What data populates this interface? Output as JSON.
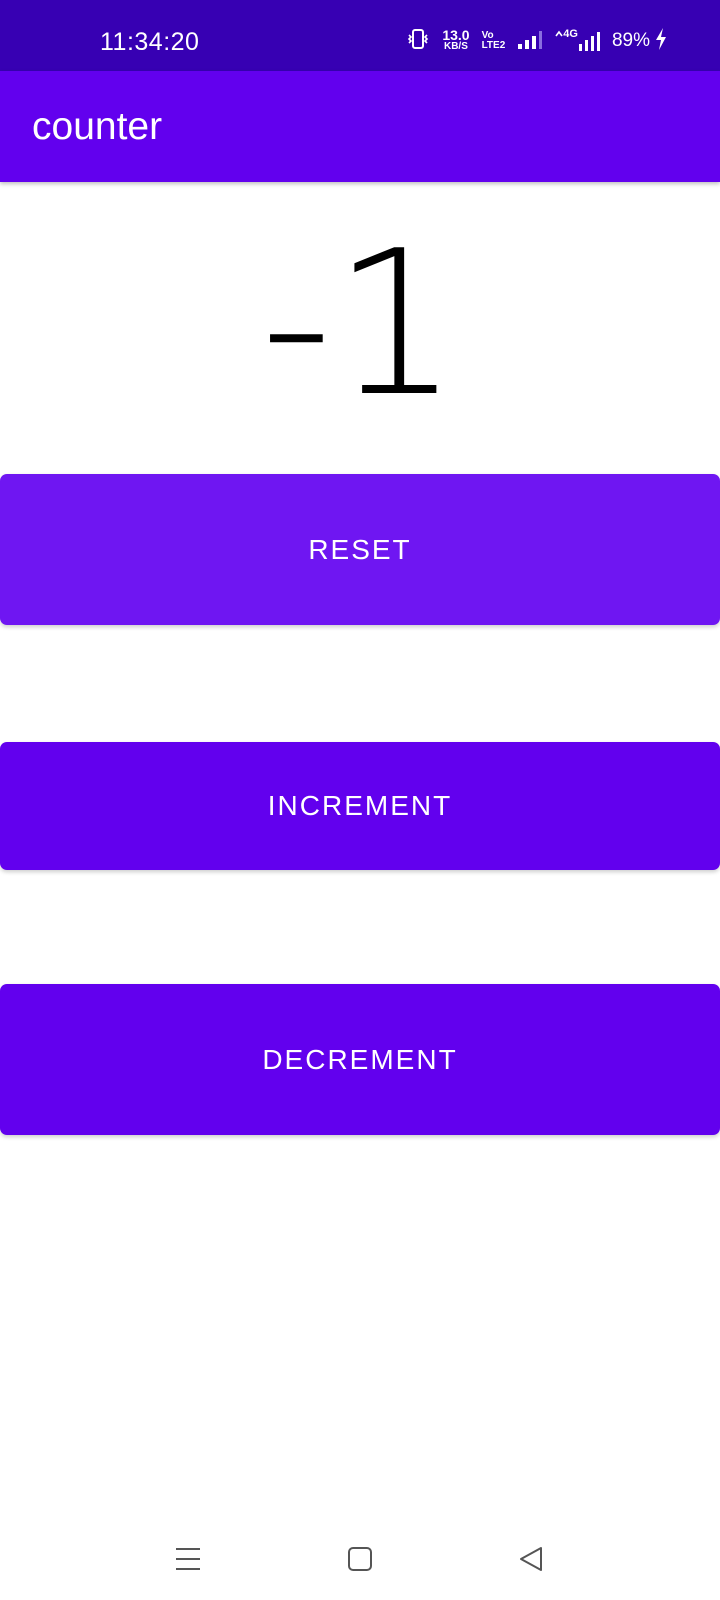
{
  "status_bar": {
    "time": "11:34:20",
    "net_speed_value": "13.0",
    "net_speed_unit": "KB/S",
    "volte_top": "Vo",
    "volte_bottom": "LTE2",
    "network_type": "4G",
    "battery": "89%",
    "icons": [
      "vibrate-icon",
      "signal-icon",
      "data-arrows-icon",
      "signal-icon",
      "charging-bolt-icon"
    ]
  },
  "app_bar": {
    "title": "counter"
  },
  "counter": {
    "value": "-1"
  },
  "buttons": {
    "reset": "RESET",
    "increment": "INCREMENT",
    "decrement": "DECREMENT"
  },
  "nav_bar": {
    "icons": [
      "menu-icon",
      "home-icon",
      "back-icon"
    ]
  },
  "colors": {
    "status_bar": "#3700b3",
    "app_bar": "#6200ee",
    "button_reset": "#6f16f2",
    "button": "#6200ee"
  }
}
